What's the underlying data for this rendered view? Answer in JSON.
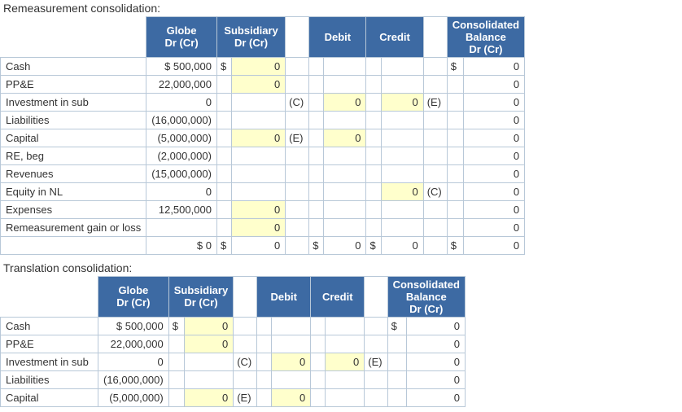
{
  "sections": {
    "remeasurement_title": "Remeasurement consolidation:",
    "translation_title": "Translation consolidation:"
  },
  "headers": {
    "globe_l1": "Globe",
    "globe_l2": "Dr (Cr)",
    "sub_l1": "Subsidiary",
    "sub_l2": "Dr (Cr)",
    "debit": "Debit",
    "credit": "Credit",
    "consol_l1": "Consolidated",
    "consol_l2": "Balance",
    "consol_l3": "Dr (Cr)"
  },
  "remeasurement": {
    "rows": [
      {
        "label": "Cash",
        "globe": "$ 500,000",
        "sub_sym": "$",
        "sub": "0",
        "dc1": "",
        "debit_sym": "",
        "debit": "",
        "credit_sym": "",
        "credit": "",
        "dc2": "",
        "bal_sym": "$",
        "bal": "0"
      },
      {
        "label": "PP&E",
        "globe": "22,000,000",
        "sub_sym": "",
        "sub": "0",
        "dc1": "",
        "debit_sym": "",
        "debit": "",
        "credit_sym": "",
        "credit": "",
        "dc2": "",
        "bal_sym": "",
        "bal": "0"
      },
      {
        "label": "Investment in sub",
        "globe": "0",
        "sub_sym": "",
        "sub": "",
        "dc1": "(C)",
        "debit_sym": "",
        "debit": "0",
        "credit_sym": "",
        "credit": "0",
        "dc2": "(E)",
        "bal_sym": "",
        "bal": "0"
      },
      {
        "label": "Liabilities",
        "globe": "(16,000,000)",
        "sub_sym": "",
        "sub": "",
        "dc1": "",
        "debit_sym": "",
        "debit": "",
        "credit_sym": "",
        "credit": "",
        "dc2": "",
        "bal_sym": "",
        "bal": "0"
      },
      {
        "label": "Capital",
        "globe": "(5,000,000)",
        "sub_sym": "",
        "sub": "0",
        "dc1": "(E)",
        "debit_sym": "",
        "debit": "0",
        "credit_sym": "",
        "credit": "",
        "dc2": "",
        "bal_sym": "",
        "bal": "0"
      },
      {
        "label": "RE, beg",
        "globe": "(2,000,000)",
        "sub_sym": "",
        "sub": "",
        "dc1": "",
        "debit_sym": "",
        "debit": "",
        "credit_sym": "",
        "credit": "",
        "dc2": "",
        "bal_sym": "",
        "bal": "0"
      },
      {
        "label": "Revenues",
        "globe": "(15,000,000)",
        "sub_sym": "",
        "sub": "",
        "dc1": "",
        "debit_sym": "",
        "debit": "",
        "credit_sym": "",
        "credit": "",
        "dc2": "",
        "bal_sym": "",
        "bal": "0"
      },
      {
        "label": "Equity in NL",
        "globe": "0",
        "sub_sym": "",
        "sub": "",
        "dc1": "",
        "debit_sym": "",
        "debit": "",
        "credit_sym": "",
        "credit": "0",
        "dc2": "(C)",
        "bal_sym": "",
        "bal": "0"
      },
      {
        "label": "Expenses",
        "globe": "12,500,000",
        "sub_sym": "",
        "sub": "0",
        "dc1": "",
        "debit_sym": "",
        "debit": "",
        "credit_sym": "",
        "credit": "",
        "dc2": "",
        "bal_sym": "",
        "bal": "0"
      },
      {
        "label": "Remeasurement gain or loss",
        "globe": "",
        "sub_sym": "",
        "sub": "0",
        "dc1": "",
        "debit_sym": "",
        "debit": "",
        "credit_sym": "",
        "credit": "",
        "dc2": "",
        "bal_sym": "",
        "bal": "0"
      }
    ],
    "total": {
      "globe_sym": "$",
      "globe": "0",
      "sub_sym": "$",
      "sub": "0",
      "debit_sym": "$",
      "debit": "0",
      "credit_sym": "$",
      "credit": "0",
      "bal_sym": "$",
      "bal": "0"
    }
  },
  "translation": {
    "rows": [
      {
        "label": "Cash",
        "globe": "$ 500,000",
        "sub_sym": "$",
        "sub": "0",
        "dc1": "",
        "debit_sym": "",
        "debit": "",
        "credit_sym": "",
        "credit": "",
        "dc2": "",
        "bal_sym": "$",
        "bal": "0"
      },
      {
        "label": "PP&E",
        "globe": "22,000,000",
        "sub_sym": "",
        "sub": "0",
        "dc1": "",
        "debit_sym": "",
        "debit": "",
        "credit_sym": "",
        "credit": "",
        "dc2": "",
        "bal_sym": "",
        "bal": "0"
      },
      {
        "label": "Investment in sub",
        "globe": "0",
        "sub_sym": "",
        "sub": "",
        "dc1": "(C)",
        "debit_sym": "",
        "debit": "0",
        "credit_sym": "",
        "credit": "0",
        "dc2": "(E)",
        "bal_sym": "",
        "bal": "0"
      },
      {
        "label": "Liabilities",
        "globe": "(16,000,000)",
        "sub_sym": "",
        "sub": "",
        "dc1": "",
        "debit_sym": "",
        "debit": "",
        "credit_sym": "",
        "credit": "",
        "dc2": "",
        "bal_sym": "",
        "bal": "0"
      },
      {
        "label": "Capital",
        "globe": "(5,000,000)",
        "sub_sym": "",
        "sub": "0",
        "dc1": "(E)",
        "debit_sym": "",
        "debit": "0",
        "credit_sym": "",
        "credit": "",
        "dc2": "",
        "bal_sym": "",
        "bal": "0"
      }
    ]
  }
}
